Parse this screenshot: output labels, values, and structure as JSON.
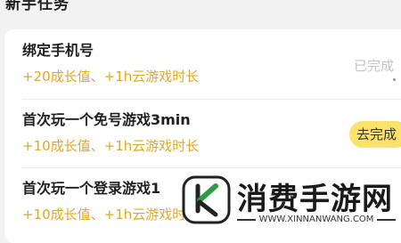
{
  "section": {
    "title": "新手任务"
  },
  "tasks": [
    {
      "name": "绑定手机号",
      "reward": "+20成长值、+1h云游戏时长",
      "action": "已完成",
      "state": "done"
    },
    {
      "name": "首次玩一个免号游戏3min",
      "reward": "+10成长值、+1h云游戏时长",
      "action": "去完成",
      "state": "todo"
    },
    {
      "name": "首次玩一个登录游戏1",
      "reward": "+10成长值、+1h云游戏时",
      "action": "",
      "state": "hidden"
    }
  ],
  "watermark": {
    "text": "消费手游网",
    "url": "WWW.XINNANWANG.COM"
  },
  "colors": {
    "reward": "#e0a72a",
    "button_bg": "#fbe26a",
    "done_text": "#c5c5c5",
    "logo_green": "#2e9b4a"
  }
}
